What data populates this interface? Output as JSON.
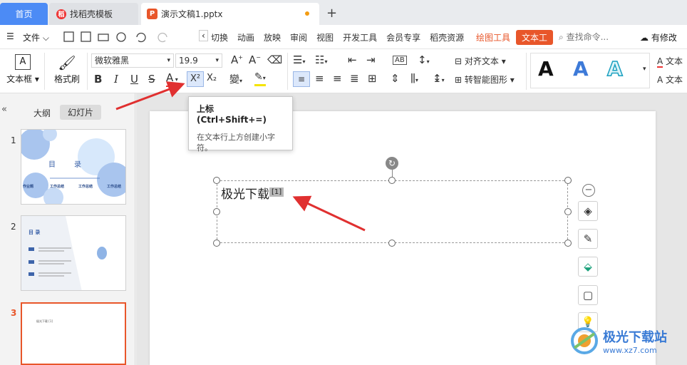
{
  "tabs": {
    "home": "首页",
    "docer": "找稻壳模板",
    "document": "演示文稿1.pptx",
    "new": "+"
  },
  "menu": {
    "file": "文件",
    "items": [
      "切换",
      "动画",
      "放映",
      "审阅",
      "视图",
      "开发工具",
      "会员专享",
      "稻壳资源"
    ],
    "draw_tools": "绘图工具",
    "text_tools": "文本工",
    "search": "查找命令...",
    "changes": "有修改"
  },
  "ribbon": {
    "textbox": "文本框",
    "format_painter": "格式刷",
    "font": "微软雅黑",
    "size": "19.9",
    "align_text": "对齐文本",
    "smartart": "转智能图形",
    "text_style_right": "文本",
    "text_style_right2": "文本",
    "bold": "B",
    "italic": "I",
    "underline": "U",
    "strike": "S",
    "sup": "X²",
    "sub": "X₂",
    "wordart": "A"
  },
  "leftpane": {
    "outline": "大纲",
    "slides": "幻灯片",
    "slide_numbers": [
      "1",
      "2",
      "3"
    ],
    "slide1_title": "目　　录",
    "slide1_labels": [
      "作业题",
      "工作总结",
      "工作总结",
      "工作总结"
    ],
    "slide2_title": "目 录",
    "slide3_text": "极光下载 [1]"
  },
  "slide": {
    "text": "极光下载",
    "superscript": "[1]"
  },
  "tooltip": {
    "title": "上标 (Ctrl+Shift+=)",
    "desc": "在文本行上方创建小字符。"
  },
  "watermark": {
    "brand": "极光下载站",
    "url": "www.xz7.com"
  },
  "colors": {
    "accent_blue": "#4c8bf5",
    "accent_orange": "#e8562a",
    "arrow_red": "#e03030"
  }
}
